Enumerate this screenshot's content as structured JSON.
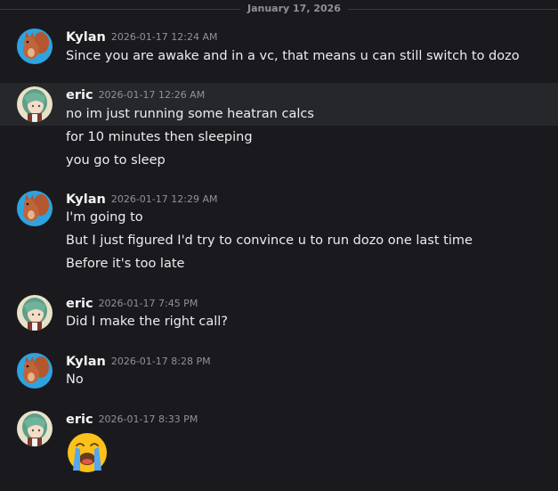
{
  "date_divider": "January 17, 2026",
  "messages": [
    {
      "author": "Kylan",
      "timestamp": "2026-01-17 12:24 AM",
      "avatar": "squirrel-avatar",
      "lines": [
        "Since you are awake and in a vc, that means u can still switch to dozo"
      ]
    },
    {
      "author": "eric",
      "timestamp": "2026-01-17 12:26 AM",
      "avatar": "anime-girl-avatar",
      "lines": [
        "no im just running some heatran calcs",
        "for 10 minutes then sleeping",
        "you go to sleep"
      ]
    },
    {
      "author": "Kylan",
      "timestamp": "2026-01-17 12:29 AM",
      "avatar": "squirrel-avatar",
      "lines": [
        "I'm going to",
        "But I just figured I'd try to convince u to run dozo one last time",
        "Before it's too late"
      ]
    },
    {
      "author": "eric",
      "timestamp": "2026-01-17 7:45 PM",
      "avatar": "anime-girl-avatar",
      "lines": [
        "Did I make the right call?"
      ]
    },
    {
      "author": "Kylan",
      "timestamp": "2026-01-17 8:28 PM",
      "avatar": "squirrel-avatar",
      "lines": [
        "No"
      ]
    },
    {
      "author": "eric",
      "timestamp": "2026-01-17 8:33 PM",
      "avatar": "anime-girl-avatar",
      "lines": [],
      "emoji": "loudly-crying-face-emoji"
    }
  ],
  "colors": {
    "background": "#1a1a1e",
    "hover_row": "#26272b",
    "author": "#f2f3f5",
    "text": "#ebedef",
    "muted": "#8e9297"
  }
}
